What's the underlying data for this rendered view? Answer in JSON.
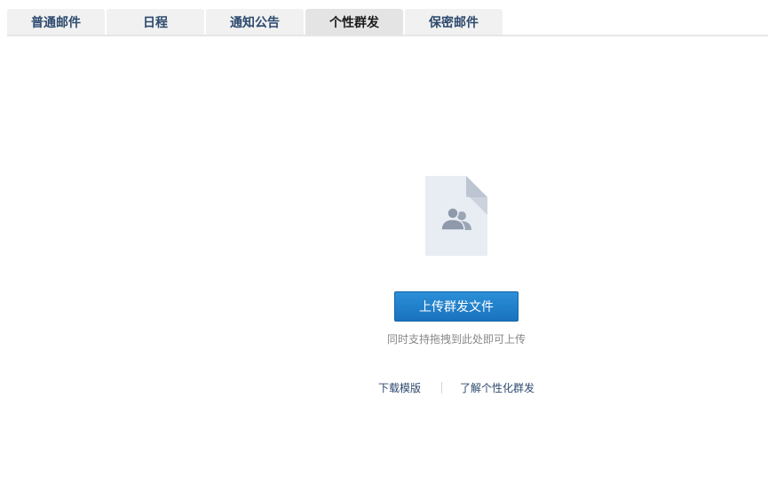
{
  "tabs": [
    {
      "label": "普通邮件",
      "active": false
    },
    {
      "label": "日程",
      "active": false
    },
    {
      "label": "通知公告",
      "active": false
    },
    {
      "label": "个性群发",
      "active": true
    },
    {
      "label": "保密邮件",
      "active": false
    }
  ],
  "upload": {
    "icon": "group-file-icon",
    "button_label": "上传群发文件",
    "hint": "同时支持拖拽到此处即可上传"
  },
  "links": {
    "download_template": "下载模版",
    "learn_more": "了解个性化群发"
  },
  "colors": {
    "accent": "#1a72bd",
    "tab_text": "#2d4a6e",
    "icon_fill": "#e8edf3",
    "icon_figure": "#9aa6b6"
  }
}
